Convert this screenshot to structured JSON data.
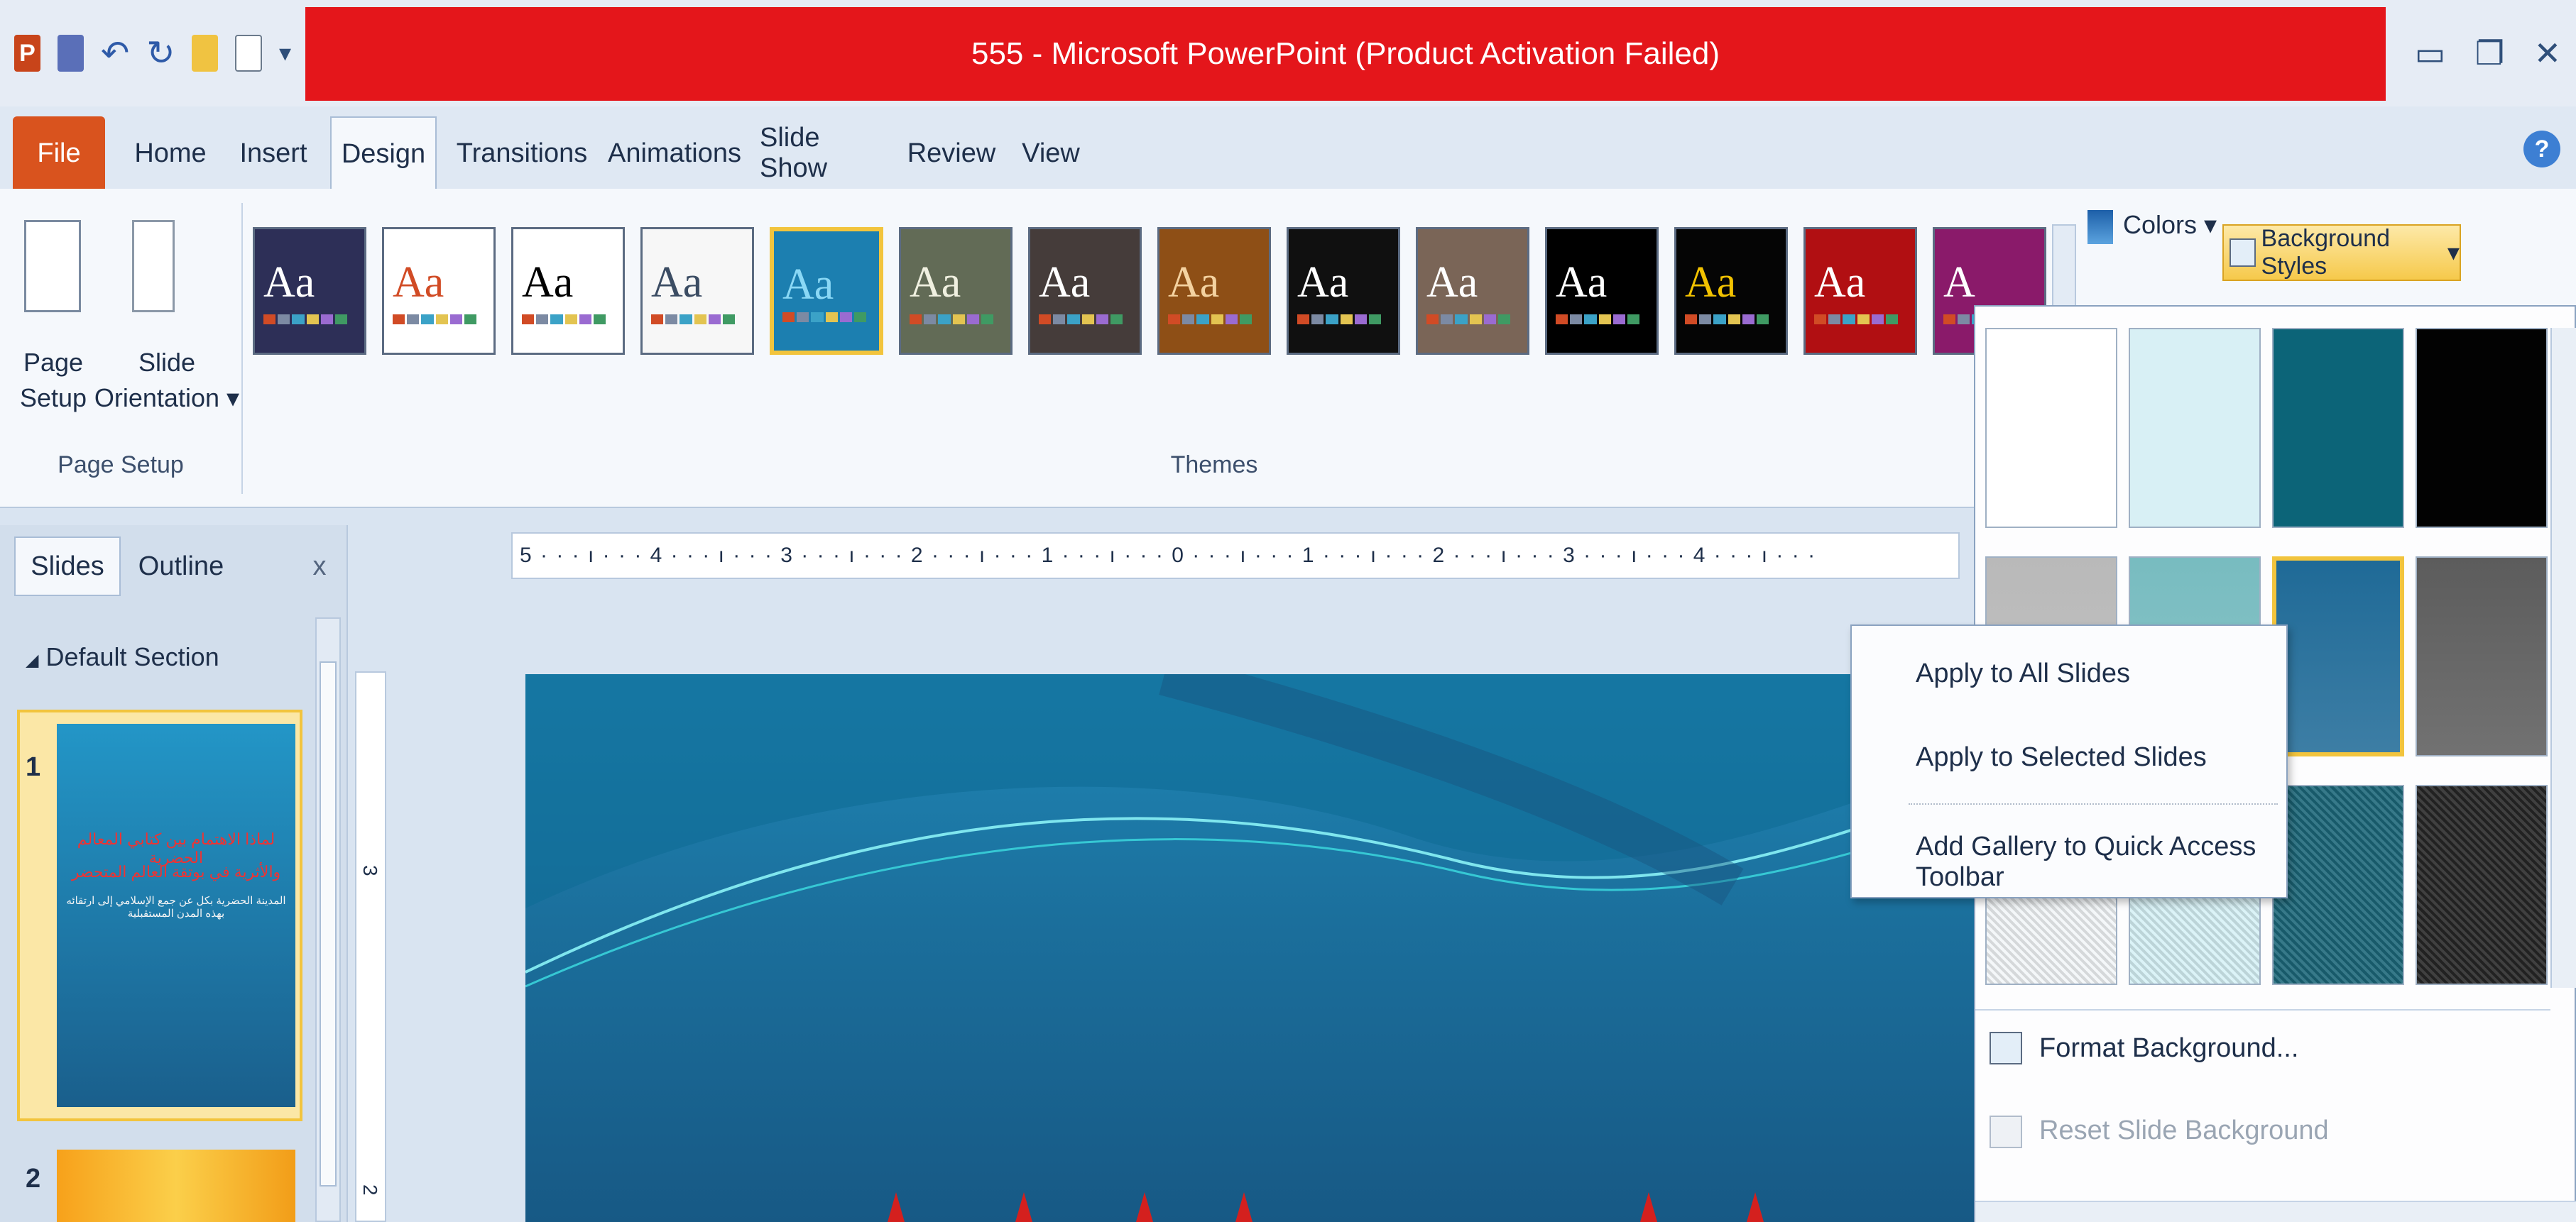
{
  "title_bar": {
    "title": "555 - Microsoft PowerPoint (Product Activation Failed)",
    "qat_icons": [
      "powerpoint-logo-icon",
      "save-icon",
      "undo-icon",
      "redo-icon",
      "open-icon",
      "new-icon",
      "customize-qat-icon"
    ],
    "window_controls": [
      "minimize-icon",
      "restore-icon",
      "close-icon"
    ]
  },
  "tabs": [
    "File",
    "Home",
    "Insert",
    "Design",
    "Transitions",
    "Animations",
    "Slide Show",
    "Review",
    "View"
  ],
  "active_tab": "Design",
  "ribbon": {
    "page_setup": {
      "page_setup_label_1": "Page",
      "page_setup_label_2": "Setup",
      "slide_orientation_label_1": "Slide",
      "slide_orientation_label_2": "Orientation",
      "dropdown_glyph": "▾",
      "group_label": "Page Setup"
    },
    "themes": {
      "group_label": "Themes",
      "items": [
        {
          "aa": "Aa",
          "bg": "#2d2f57",
          "fg": "#ffffff"
        },
        {
          "aa": "Aa",
          "bg": "#ffffff",
          "fg": "#d14b25"
        },
        {
          "aa": "Aa",
          "bg": "#ffffff",
          "fg": "#000000"
        },
        {
          "aa": "Aa",
          "bg": "#f7f7f7",
          "fg": "#3b4c63"
        },
        {
          "aa": "Aa",
          "bg": "#1c7fb0",
          "fg": "#8ad8f5"
        },
        {
          "aa": "Aa",
          "bg": "#626b56",
          "fg": "#f0f0e0"
        },
        {
          "aa": "Aa",
          "bg": "#453c3a",
          "fg": "#ffffff"
        },
        {
          "aa": "Aa",
          "bg": "#8e4f16",
          "fg": "#f4d2a0"
        },
        {
          "aa": "Aa",
          "bg": "#101010",
          "fg": "#ffffff"
        },
        {
          "aa": "Aa",
          "bg": "#7a6557",
          "fg": "#ffffff"
        },
        {
          "aa": "Aa",
          "bg": "#000000",
          "fg": "#ffffff"
        },
        {
          "aa": "Aa",
          "bg": "#050505",
          "fg": "#f2c200"
        },
        {
          "aa": "Aa",
          "bg": "#b10f12",
          "fg": "#ffffff"
        },
        {
          "aa": "A",
          "bg": "#8a1a6a",
          "fg": "#ffffff"
        }
      ]
    },
    "colors_label": "Colors",
    "colors_dropdown": "▾",
    "background_styles_label": "Background Styles",
    "background_styles_dropdown": "▾"
  },
  "slides_pane": {
    "tabs": [
      "Slides",
      "Outline"
    ],
    "close": "x",
    "section_label": "Default Section",
    "slides": [
      {
        "number": "1",
        "arabic_lines": [
          "لماذا الاهتمام بين كتابي المعالم الحضرية",
          "والأثرية في بوتقة العالم المتحضر",
          "المدينة الحضرية بكل عن جمع الإسلامي إلى ارتقائه بهذه المدن المستقبلية"
        ]
      },
      {
        "number": "2"
      }
    ]
  },
  "ruler": {
    "text": "5 · · · ı · · · 4 · · · ı · · · 3 · · · ı · · · 2 · · · ı · · · 1 · · · ı · · · 0 · · · ı · · · 1 · · · ı · · · 2 · · · ı · · · 3 · · · ı · · · 4 · · · ı · · ·",
    "vertical_marks": [
      "3",
      "2"
    ]
  },
  "background_dropdown": {
    "swatches": [
      {
        "color": "#ffffff"
      },
      {
        "color": "#d8f0f5"
      },
      {
        "color": "#0c6478"
      },
      {
        "color": "#020202"
      },
      {
        "color": "#b9b9b9"
      },
      {
        "color": "#78bcc0"
      },
      {
        "color": "#1f6a97"
      },
      {
        "color": "#5c5c5c"
      },
      {
        "color": "#f2f6f8"
      },
      {
        "color": "#d6f1f6"
      },
      {
        "color": "#1b6779"
      },
      {
        "color": "#262626"
      }
    ],
    "format_background_label": "Format Background...",
    "reset_slide_background_label": "Reset Slide Background"
  },
  "context_menu": {
    "items": [
      "Apply to All Slides",
      "Apply to Selected Slides",
      "Add Gallery to Quick Access Toolbar"
    ]
  }
}
